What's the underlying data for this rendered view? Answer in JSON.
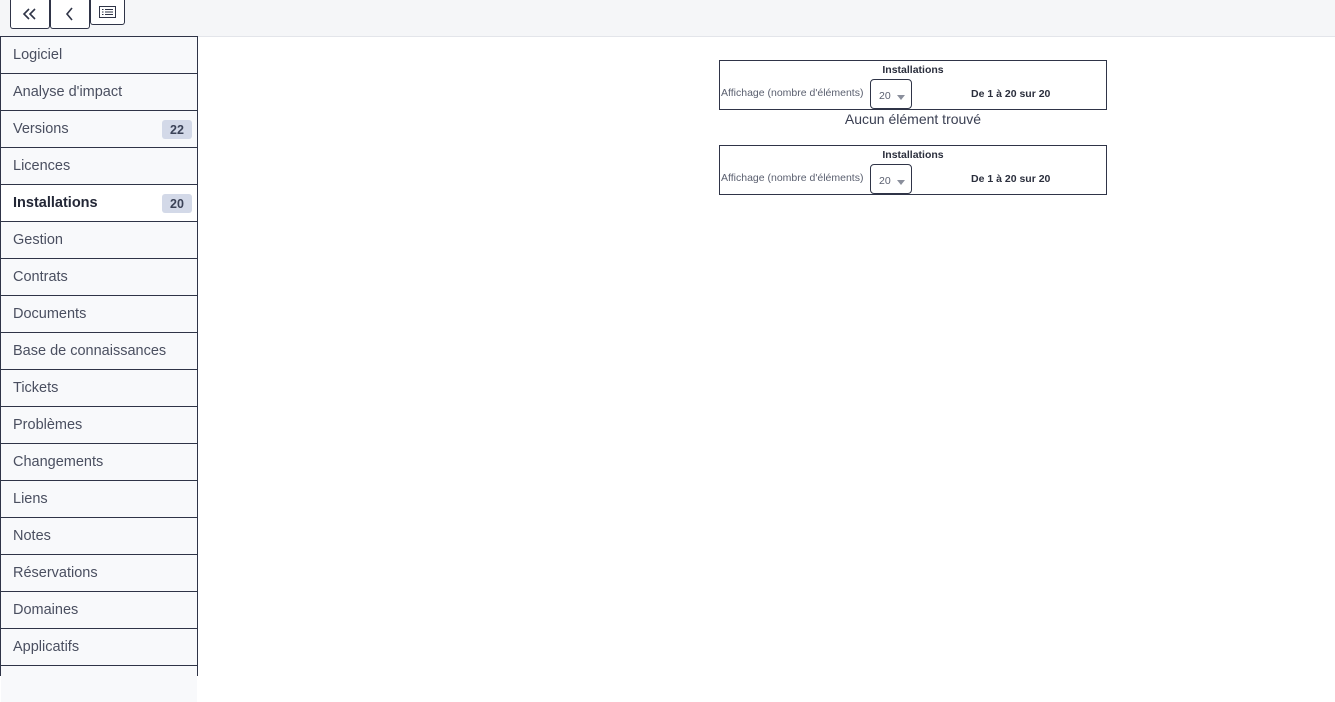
{
  "toolbar": {
    "first_icon": "double-chevron-left-icon",
    "prev_icon": "chevron-left-icon",
    "list_icon": "list-view-icon"
  },
  "tabs": [
    {
      "label": "Logiciel"
    },
    {
      "label": "Analyse d'impact"
    },
    {
      "label": "Versions",
      "count": "22"
    },
    {
      "label": "Licences"
    },
    {
      "label": "Installations",
      "count": "20",
      "active": true
    },
    {
      "label": "Gestion"
    },
    {
      "label": "Contrats"
    },
    {
      "label": "Documents"
    },
    {
      "label": "Base de connaissances"
    },
    {
      "label": "Tickets"
    },
    {
      "label": "Problèmes"
    },
    {
      "label": "Changements"
    },
    {
      "label": "Liens"
    },
    {
      "label": "Notes"
    },
    {
      "label": "Réservations"
    },
    {
      "label": "Domaines"
    },
    {
      "label": "Applicatifs"
    },
    {
      "label": ""
    }
  ],
  "pager_top": {
    "title": "Installations",
    "display_label": "Affichage (nombre d'éléments)",
    "page_size": "20",
    "range": "De 1 à 20 sur 20"
  },
  "pager_bottom": {
    "title": "Installations",
    "display_label": "Affichage (nombre d'éléments)",
    "page_size": "20",
    "range": "De 1 à 20 sur 20"
  },
  "empty_message": "Aucun élément trouvé",
  "colors": {
    "border": "#2f3447",
    "badge_bg": "#d3d9e8",
    "topbar_bg": "#f5f6f8"
  }
}
